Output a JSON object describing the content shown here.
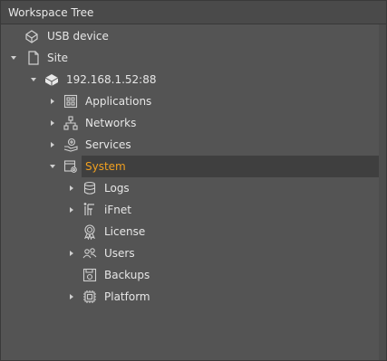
{
  "panel": {
    "title": "Workspace Tree"
  },
  "tree": {
    "usb_device": "USB device",
    "site": "Site",
    "host": "192.168.1.52:88",
    "applications": "Applications",
    "networks": "Networks",
    "services": "Services",
    "system": "System",
    "logs": "Logs",
    "ifnet": "iFnet",
    "license": "License",
    "users": "Users",
    "backups": "Backups",
    "platform": "Platform"
  },
  "colors": {
    "panel_bg": "#545454",
    "header_bg": "#4a4a4a",
    "text": "#e6e6e6",
    "selected_text": "#f0a020",
    "selected_bg": "#3f3f3f",
    "icon": "#cfcfcf"
  }
}
